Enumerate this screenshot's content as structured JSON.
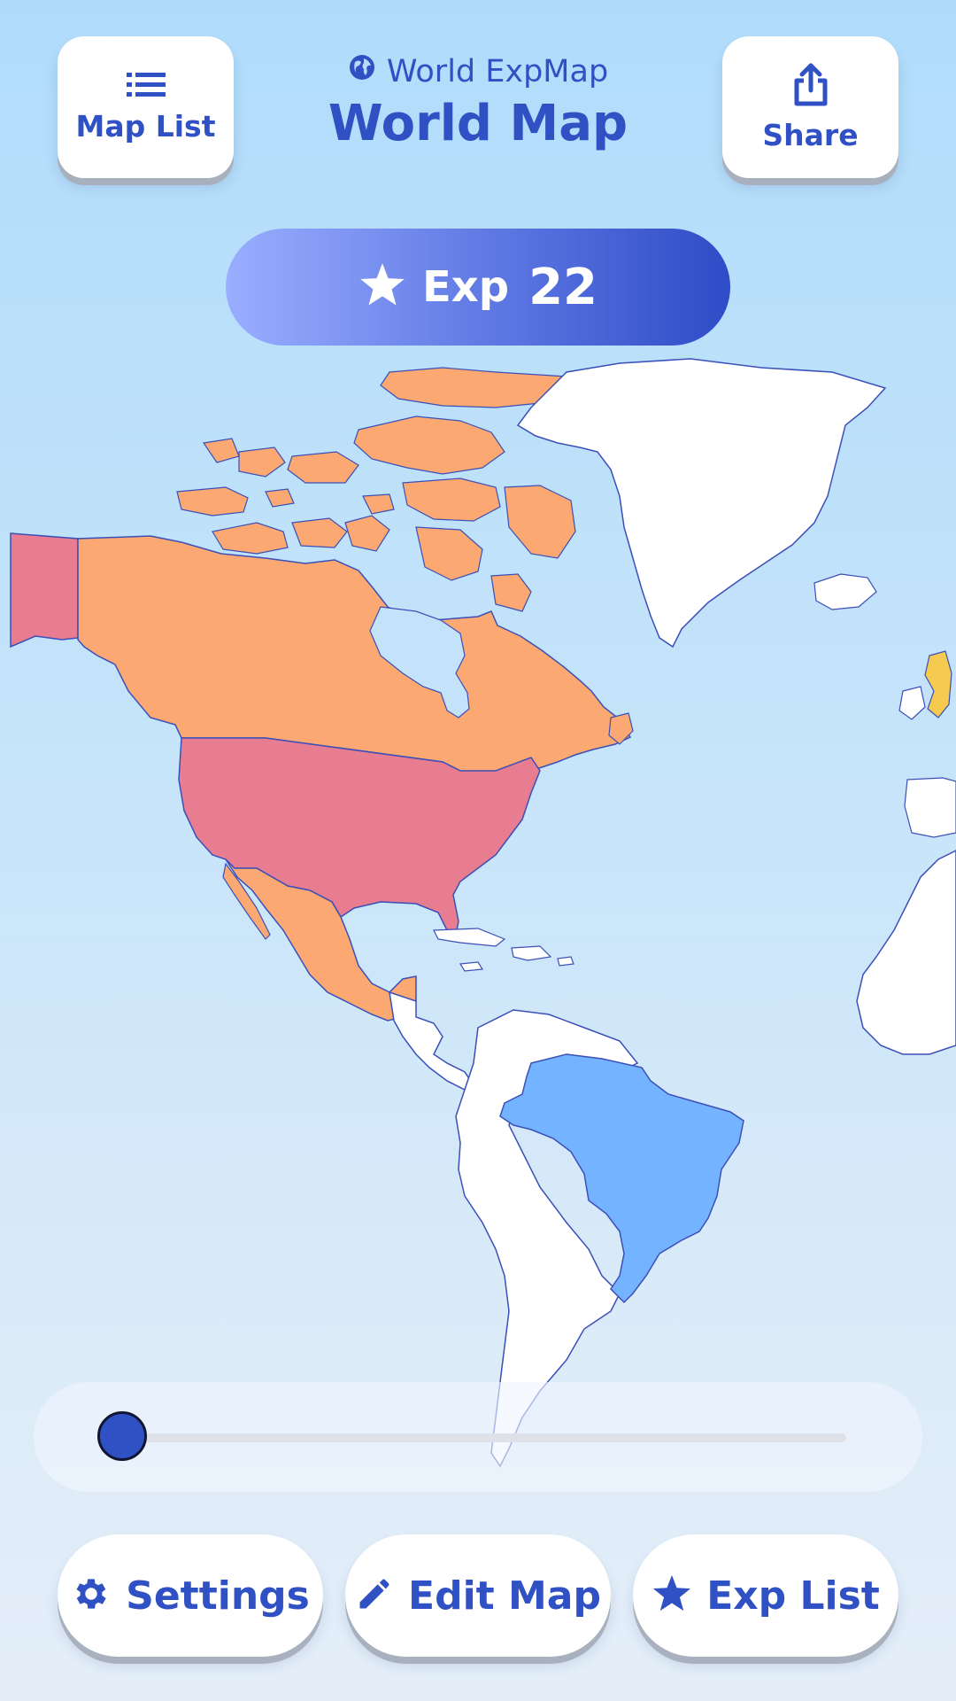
{
  "header": {
    "app_name": "World ExpMap",
    "title": "World Map",
    "map_list_label": "Map List",
    "share_label": "Share"
  },
  "exp": {
    "label": "Exp",
    "value": "22"
  },
  "map": {
    "colors": {
      "ocean": "#c4e3fa",
      "canada": "#fca873",
      "usa": "#e87c90",
      "alaska": "#e87c90",
      "mexico": "#fca873",
      "brazil": "#73b3ff",
      "unvisited": "#ffffff",
      "uk": "#f6c94f",
      "border": "#3b4fb8"
    }
  },
  "timeline": {
    "level": 0
  },
  "footer": {
    "settings_label": "Settings",
    "edit_map_label": "Edit Map",
    "exp_list_label": "Exp List"
  },
  "theme": {
    "accent": "#2f51c4",
    "pill_start": "#9aaeff",
    "pill_end": "#2e4cc6"
  }
}
